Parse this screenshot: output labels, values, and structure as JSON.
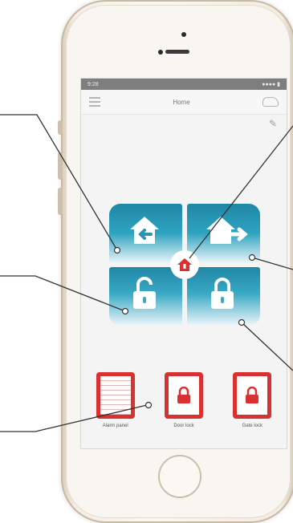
{
  "statusbar": {
    "time": "9:28",
    "right": "●●●● ▮"
  },
  "navbar": {
    "title": "Home",
    "menu_icon": "hamburger-menu-icon",
    "cloud_icon": "cloud-icon"
  },
  "edit": {
    "icon": "pencil-icon"
  },
  "modes": [
    {
      "id": "home",
      "icon": "house-enter-icon"
    },
    {
      "id": "away",
      "icon": "house-exit-icon"
    },
    {
      "id": "disarmed",
      "icon": "unlock-icon"
    },
    {
      "id": "armed",
      "icon": "lock-icon"
    }
  ],
  "center_icon": "house-alarm-icon",
  "devices": [
    {
      "label": "Alarm panel",
      "icon": "panel-icon"
    },
    {
      "label": "Door lock",
      "icon": "lock-icon"
    },
    {
      "label": "Gate lock",
      "icon": "lock-icon"
    }
  ],
  "colors": {
    "tile": "#2ea3bf",
    "accent": "#d93030"
  }
}
